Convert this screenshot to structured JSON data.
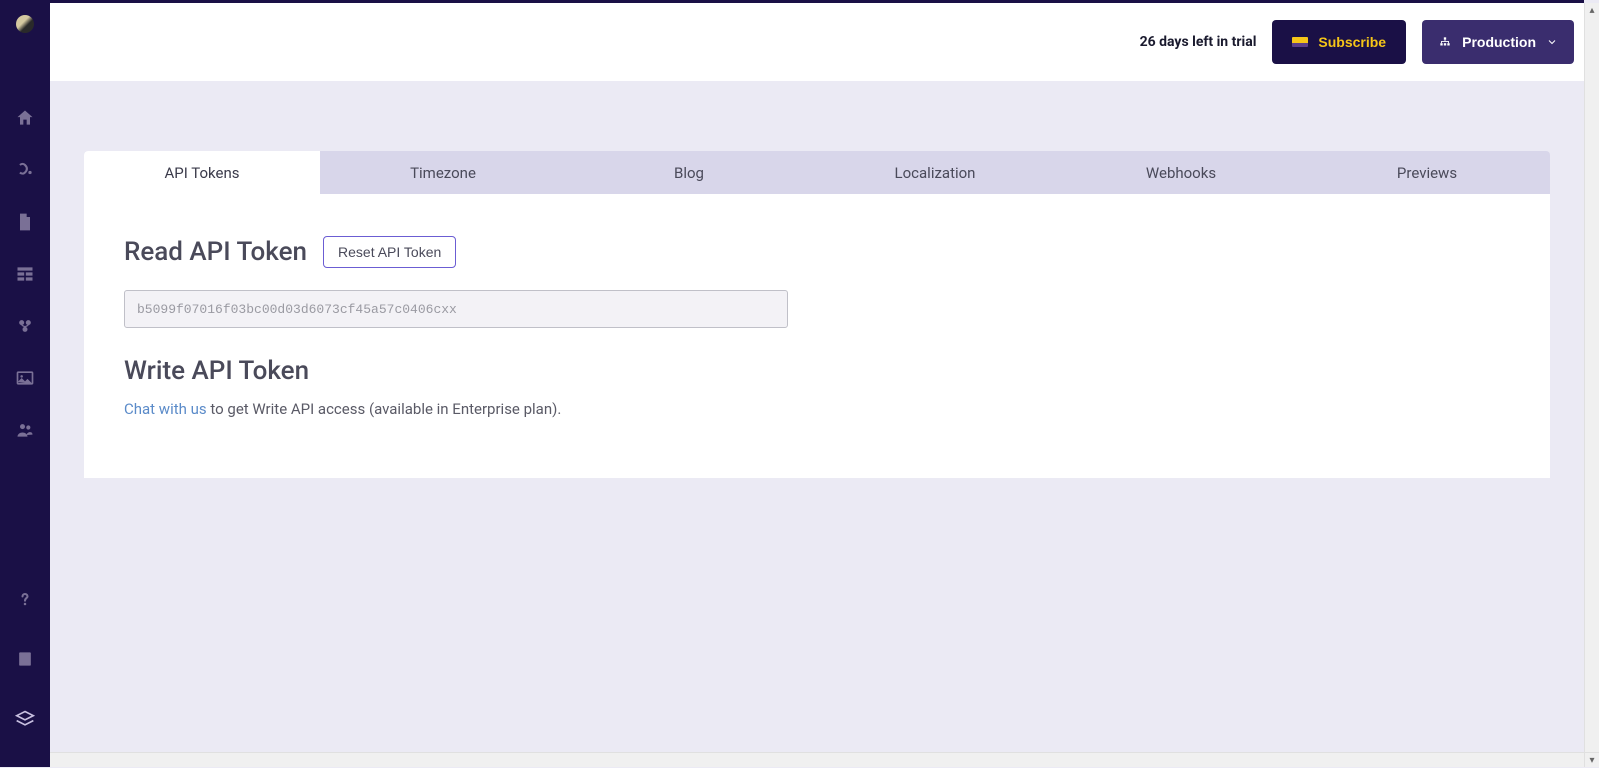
{
  "header": {
    "trial_text": "26 days left in trial",
    "subscribe_label": "Subscribe",
    "production_label": "Production"
  },
  "tabs": [
    {
      "label": "API Tokens",
      "active": true
    },
    {
      "label": "Timezone",
      "active": false
    },
    {
      "label": "Blog",
      "active": false
    },
    {
      "label": "Localization",
      "active": false
    },
    {
      "label": "Webhooks",
      "active": false
    },
    {
      "label": "Previews",
      "active": false
    }
  ],
  "read_token": {
    "title": "Read API Token",
    "reset_label": "Reset API Token",
    "value": "b5099f07016f03bc00d03d6073cf45a57c0406cxx"
  },
  "write_token": {
    "title": "Write API Token",
    "chat_link_text": "Chat with us",
    "description_suffix": " to get Write API access (available in Enterprise plan)."
  },
  "sidebar": {
    "icons": [
      "home",
      "blog",
      "page",
      "table",
      "layers-group",
      "image",
      "team",
      "help",
      "book",
      "stack"
    ]
  }
}
